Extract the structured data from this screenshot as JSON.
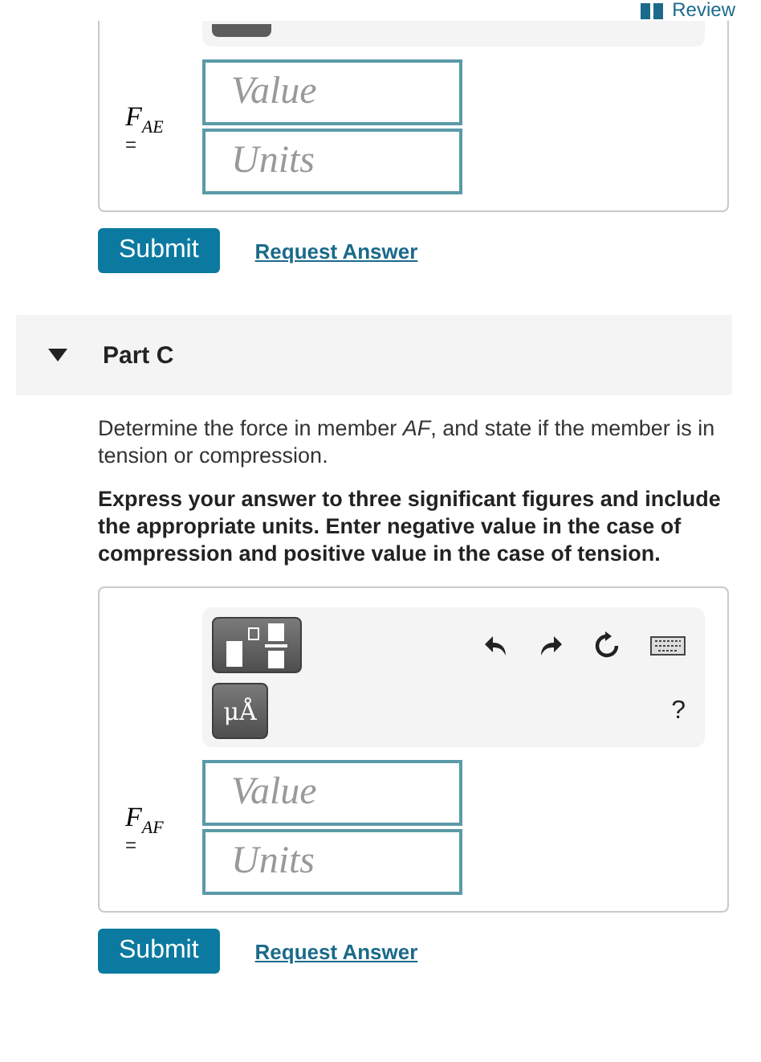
{
  "review_link": {
    "label": "Review"
  },
  "part_b": {
    "answer": {
      "label": "F$_{AE}$",
      "equals": "=",
      "value_placeholder": "Value",
      "units_placeholder": "Units"
    },
    "submit": "Submit",
    "request_answer": "Request Answer"
  },
  "part_c": {
    "title": "Part C",
    "expanded": true,
    "question": "Determine the force in member *AF*, and state if the member is in tension or compression.",
    "instruction": "Express your answer to three significant figures and include the appropriate units. Enter negative value in the case of compression and positive value in the case of tension.",
    "toolbar": {
      "units_button": "μÅ",
      "help": "?"
    },
    "answer": {
      "label": "F$_{AF}$",
      "equals": "=",
      "value_placeholder": "Value",
      "units_placeholder": "Units"
    },
    "submit": "Submit",
    "request_answer": "Request Answer"
  }
}
